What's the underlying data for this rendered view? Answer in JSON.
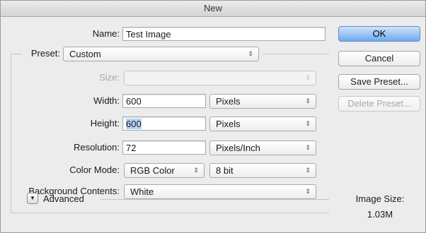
{
  "window": {
    "title": "New"
  },
  "form": {
    "name": {
      "label": "Name:",
      "value": "Test Image"
    },
    "preset": {
      "label": "Preset:",
      "value": "Custom"
    },
    "size": {
      "label": "Size:",
      "value": ""
    },
    "width": {
      "label": "Width:",
      "value": "600",
      "unit": "Pixels"
    },
    "height": {
      "label": "Height:",
      "value": "600",
      "unit": "Pixels"
    },
    "resolution": {
      "label": "Resolution:",
      "value": "72",
      "unit": "Pixels/Inch"
    },
    "color_mode": {
      "label": "Color Mode:",
      "value": "RGB Color",
      "depth": "8 bit"
    },
    "background": {
      "label": "Background Contents:",
      "value": "White"
    },
    "advanced": {
      "label": "Advanced"
    }
  },
  "buttons": {
    "ok": "OK",
    "cancel": "Cancel",
    "save_preset": "Save Preset...",
    "delete_preset": "Delete Preset..."
  },
  "info": {
    "image_size_label": "Image Size:",
    "image_size_value": "1.03M"
  },
  "icons": {
    "popup_arrows": "⇕",
    "disclosure": "▼"
  },
  "colors": {
    "accent": "#6fa9ec",
    "selection": "#b5d4f5"
  }
}
